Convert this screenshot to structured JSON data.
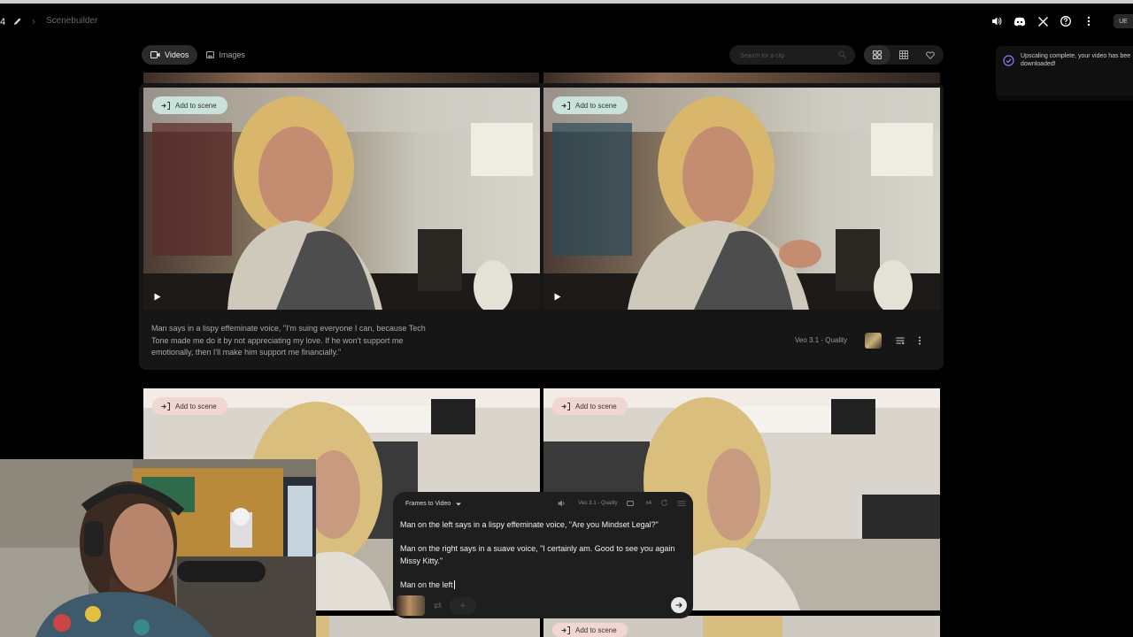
{
  "header": {
    "project_number": "4",
    "breadcrumb": "Scenebuilder",
    "icons": [
      "volume-icon",
      "discord-icon",
      "x-logo-icon",
      "help-icon",
      "more-vert-icon"
    ],
    "user_initials": "UE"
  },
  "toolbar": {
    "tabs": [
      {
        "label": "Videos",
        "icon": "video-icon",
        "active": true
      },
      {
        "label": "Images",
        "icon": "image-icon",
        "active": false
      }
    ],
    "search_placeholder": "Search for a clip",
    "view_modes": [
      "grid-large-icon",
      "grid-small-icon",
      "favorite-icon"
    ]
  },
  "toast": {
    "message": "Upscaling complete, your video has bee\ndownloaded!",
    "icon": "check-circle-icon"
  },
  "clip_card_1": {
    "add_to_scene_label": "Add to scene",
    "prompt": "Man says in a lispy effeminate voice, \"I'm suing everyone I can, because Tech Tone made me do it by not appreciating my love. If he won't support me emotionally, then I'll make him support me financially.\"",
    "model": "Veo 3.1 - Quality"
  },
  "clip_card_2": {
    "add_to_scene_label": "Add to scene"
  },
  "clip_card_3": {
    "add_to_scene_label": "Add to scene"
  },
  "composer": {
    "mode": "Frames to Video",
    "model": "Veo 3.1 - Quality",
    "count": "x4",
    "lines": [
      "Man on the left says in a lispy effeminate voice, \"Are you Mindset Legal?\"",
      "Man on the right says in a suave voice, \"I certainly am. Good to see you again Missy Kitty.\"",
      "Man on the left"
    ]
  },
  "colors": {
    "accent_violet": "#8b7cf6",
    "add_scene_light": "#c9e3dc",
    "add_scene_pink": "#f2d6d3"
  }
}
